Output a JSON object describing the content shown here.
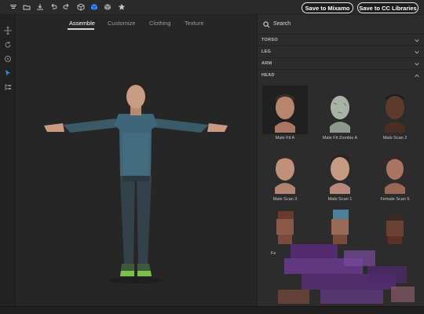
{
  "toolbar": {
    "icons": [
      "import-icon",
      "open-icon",
      "download-icon",
      "undo-icon",
      "redo-icon",
      "cube-icon",
      "cube-filled-icon",
      "cube-outline-icon",
      "star-icon"
    ],
    "save_mixamo": "Save to Mixamo",
    "save_cc": "Save to CC Libraries"
  },
  "tabs": [
    "Assemble",
    "Customize",
    "Clothing",
    "Texture"
  ],
  "active_tab": "Assemble",
  "search": {
    "placeholder": "Search"
  },
  "categories": [
    "TORSO",
    "LEG",
    "ARM",
    "HEAD"
  ],
  "heads": [
    {
      "label": "Male Fit A",
      "selected": true
    },
    {
      "label": "Male Fit Zombie A",
      "selected": false
    },
    {
      "label": "Male Scan 2",
      "selected": false
    },
    {
      "label": "Male Scan 3",
      "selected": false
    },
    {
      "label": "Male Scan 1",
      "selected": false
    },
    {
      "label": "Female Scan 5",
      "selected": false
    }
  ],
  "partial_label": "Fe",
  "colors": {
    "accent": "#2f8cff",
    "panel": "#2c2c2c",
    "viewport": "#262626"
  }
}
